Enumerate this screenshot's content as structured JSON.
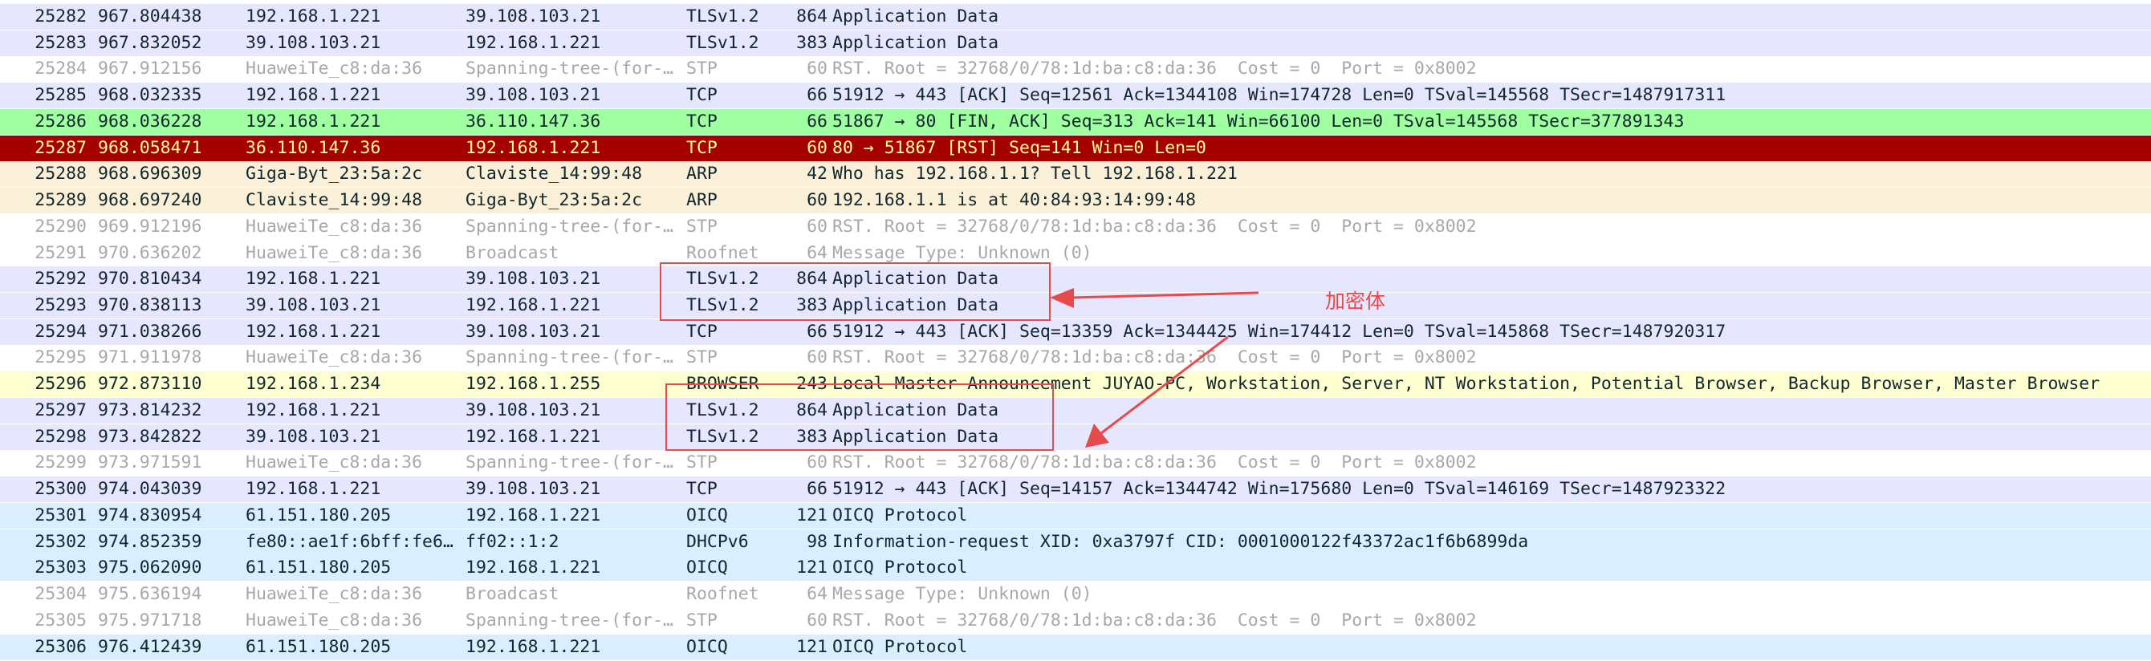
{
  "colors": {
    "tls_bg": "#e7e6ff",
    "tls_fg": "#12272e",
    "tcp_bg": "#e7e6ff",
    "tcp_fg": "#12272e",
    "stp_bg": "#ffffff",
    "stp_fg": "#a8a8a8",
    "fin_bg": "#a0ffa0",
    "fin_fg": "#12272e",
    "rst_bg": "#a40000",
    "rst_fg": "#fffc9c",
    "arp_bg": "#faf0d7",
    "arp_fg": "#12272e",
    "browser_bg": "#feffd0",
    "browser_fg": "#12272e",
    "udp_bg": "#daeeff",
    "udp_fg": "#12272e",
    "annotation": "#e64a4a"
  },
  "packets": [
    {
      "no": "25282",
      "time": "967.804438",
      "src": "192.168.1.221",
      "dst": "39.108.103.21",
      "proto": "TLSv1.2",
      "len": "864",
      "info": "Application Data",
      "style": "tls"
    },
    {
      "no": "25283",
      "time": "967.832052",
      "src": "39.108.103.21",
      "dst": "192.168.1.221",
      "proto": "TLSv1.2",
      "len": "383",
      "info": "Application Data",
      "style": "tls"
    },
    {
      "no": "25284",
      "time": "967.912156",
      "src": "HuaweiTe_c8:da:36",
      "dst": "Spanning-tree-(for-…",
      "proto": "STP",
      "len": "60",
      "info": "RST. Root = 32768/0/78:1d:ba:c8:da:36  Cost = 0  Port = 0x8002",
      "style": "stp"
    },
    {
      "no": "25285",
      "time": "968.032335",
      "src": "192.168.1.221",
      "dst": "39.108.103.21",
      "proto": "TCP",
      "len": "66",
      "info": "51912 → 443 [ACK] Seq=12561 Ack=1344108 Win=174728 Len=0 TSval=145568 TSecr=1487917311",
      "style": "tcp"
    },
    {
      "no": "25286",
      "time": "968.036228",
      "src": "192.168.1.221",
      "dst": "36.110.147.36",
      "proto": "TCP",
      "len": "66",
      "info": "51867 → 80 [FIN, ACK] Seq=313 Ack=141 Win=66100 Len=0 TSval=145568 TSecr=377891343",
      "style": "fin"
    },
    {
      "no": "25287",
      "time": "968.058471",
      "src": "36.110.147.36",
      "dst": "192.168.1.221",
      "proto": "TCP",
      "len": "60",
      "info": "80 → 51867 [RST] Seq=141 Win=0 Len=0",
      "style": "rst"
    },
    {
      "no": "25288",
      "time": "968.696309",
      "src": "Giga-Byt_23:5a:2c",
      "dst": "Claviste_14:99:48",
      "proto": "ARP",
      "len": "42",
      "info": "Who has 192.168.1.1? Tell 192.168.1.221",
      "style": "arp"
    },
    {
      "no": "25289",
      "time": "968.697240",
      "src": "Claviste_14:99:48",
      "dst": "Giga-Byt_23:5a:2c",
      "proto": "ARP",
      "len": "60",
      "info": "192.168.1.1 is at 40:84:93:14:99:48",
      "style": "arp"
    },
    {
      "no": "25290",
      "time": "969.912196",
      "src": "HuaweiTe_c8:da:36",
      "dst": "Spanning-tree-(for-…",
      "proto": "STP",
      "len": "60",
      "info": "RST. Root = 32768/0/78:1d:ba:c8:da:36  Cost = 0  Port = 0x8002",
      "style": "stp"
    },
    {
      "no": "25291",
      "time": "970.636202",
      "src": "HuaweiTe_c8:da:36",
      "dst": "Broadcast",
      "proto": "Roofnet",
      "len": "64",
      "info": "Message Type: Unknown (0)",
      "style": "stp"
    },
    {
      "no": "25292",
      "time": "970.810434",
      "src": "192.168.1.221",
      "dst": "39.108.103.21",
      "proto": "TLSv1.2",
      "len": "864",
      "info": "Application Data",
      "style": "tls"
    },
    {
      "no": "25293",
      "time": "970.838113",
      "src": "39.108.103.21",
      "dst": "192.168.1.221",
      "proto": "TLSv1.2",
      "len": "383",
      "info": "Application Data",
      "style": "tls"
    },
    {
      "no": "25294",
      "time": "971.038266",
      "src": "192.168.1.221",
      "dst": "39.108.103.21",
      "proto": "TCP",
      "len": "66",
      "info": "51912 → 443 [ACK] Seq=13359 Ack=1344425 Win=174412 Len=0 TSval=145868 TSecr=1487920317",
      "style": "tcp"
    },
    {
      "no": "25295",
      "time": "971.911978",
      "src": "HuaweiTe_c8:da:36",
      "dst": "Spanning-tree-(for-…",
      "proto": "STP",
      "len": "60",
      "info": "RST. Root = 32768/0/78:1d:ba:c8:da:36  Cost = 0  Port = 0x8002",
      "style": "stp"
    },
    {
      "no": "25296",
      "time": "972.873110",
      "src": "192.168.1.234",
      "dst": "192.168.1.255",
      "proto": "BROWSER",
      "len": "243",
      "info": "Local Master Announcement JUYAO-PC, Workstation, Server, NT Workstation, Potential Browser, Backup Browser, Master Browser",
      "style": "browser"
    },
    {
      "no": "25297",
      "time": "973.814232",
      "src": "192.168.1.221",
      "dst": "39.108.103.21",
      "proto": "TLSv1.2",
      "len": "864",
      "info": "Application Data",
      "style": "tls"
    },
    {
      "no": "25298",
      "time": "973.842822",
      "src": "39.108.103.21",
      "dst": "192.168.1.221",
      "proto": "TLSv1.2",
      "len": "383",
      "info": "Application Data",
      "style": "tls"
    },
    {
      "no": "25299",
      "time": "973.971591",
      "src": "HuaweiTe_c8:da:36",
      "dst": "Spanning-tree-(for-…",
      "proto": "STP",
      "len": "60",
      "info": "RST. Root = 32768/0/78:1d:ba:c8:da:36  Cost = 0  Port = 0x8002",
      "style": "stp"
    },
    {
      "no": "25300",
      "time": "974.043039",
      "src": "192.168.1.221",
      "dst": "39.108.103.21",
      "proto": "TCP",
      "len": "66",
      "info": "51912 → 443 [ACK] Seq=14157 Ack=1344742 Win=175680 Len=0 TSval=146169 TSecr=1487923322",
      "style": "tcp"
    },
    {
      "no": "25301",
      "time": "974.830954",
      "src": "61.151.180.205",
      "dst": "192.168.1.221",
      "proto": "OICQ",
      "len": "121",
      "info": "OICQ Protocol",
      "style": "udp"
    },
    {
      "no": "25302",
      "time": "974.852359",
      "src": "fe80::ae1f:6bff:fe6…",
      "dst": "ff02::1:2",
      "proto": "DHCPv6",
      "len": "98",
      "info": "Information-request XID: 0xa3797f CID: 0001000122f43372ac1f6b6899da",
      "style": "udp"
    },
    {
      "no": "25303",
      "time": "975.062090",
      "src": "61.151.180.205",
      "dst": "192.168.1.221",
      "proto": "OICQ",
      "len": "121",
      "info": "OICQ Protocol",
      "style": "udp"
    },
    {
      "no": "25304",
      "time": "975.636194",
      "src": "HuaweiTe_c8:da:36",
      "dst": "Broadcast",
      "proto": "Roofnet",
      "len": "64",
      "info": "Message Type: Unknown (0)",
      "style": "stp"
    },
    {
      "no": "25305",
      "time": "975.971718",
      "src": "HuaweiTe_c8:da:36",
      "dst": "Spanning-tree-(for-…",
      "proto": "STP",
      "len": "60",
      "info": "RST. Root = 32768/0/78:1d:ba:c8:da:36  Cost = 0  Port = 0x8002",
      "style": "stp"
    },
    {
      "no": "25306",
      "time": "976.412439",
      "src": "61.151.180.205",
      "dst": "192.168.1.221",
      "proto": "OICQ",
      "len": "121",
      "info": "OICQ Protocol",
      "style": "udp"
    }
  ],
  "annotation": {
    "label": "加密体"
  }
}
